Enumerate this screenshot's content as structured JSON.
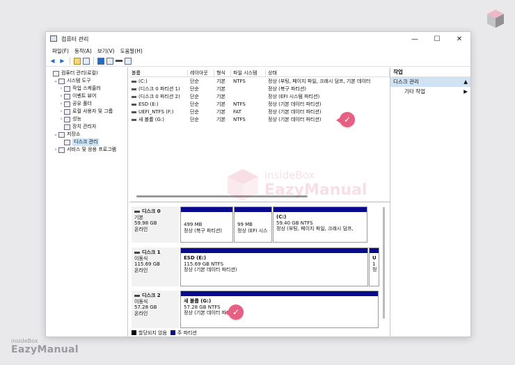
{
  "window": {
    "title": "컴퓨터 관리"
  },
  "branding": {
    "top": "insideBox",
    "bottom": "EazyManual"
  },
  "menu": [
    "파일(F)",
    "동작(A)",
    "보기(V)",
    "도움말(H)"
  ],
  "tree": [
    {
      "label": "컴퓨터 관리(로컬)",
      "indent": 0,
      "arrow": "",
      "selected": false
    },
    {
      "label": "시스템 도구",
      "indent": 1,
      "arrow": "⌄",
      "selected": false
    },
    {
      "label": "작업 스케줄러",
      "indent": 2,
      "arrow": "›",
      "selected": false
    },
    {
      "label": "이벤트 뷰어",
      "indent": 2,
      "arrow": "›",
      "selected": false
    },
    {
      "label": "공유 폴더",
      "indent": 2,
      "arrow": "›",
      "selected": false
    },
    {
      "label": "로컬 사용자 및 그룹",
      "indent": 2,
      "arrow": "›",
      "selected": false
    },
    {
      "label": "성능",
      "indent": 2,
      "arrow": "›",
      "selected": false
    },
    {
      "label": "장치 관리자",
      "indent": 2,
      "arrow": "",
      "selected": false
    },
    {
      "label": "저장소",
      "indent": 1,
      "arrow": "⌄",
      "selected": false
    },
    {
      "label": "디스크 관리",
      "indent": 2,
      "arrow": "",
      "selected": true
    },
    {
      "label": "서비스 및 응용 프로그램",
      "indent": 1,
      "arrow": "›",
      "selected": false
    }
  ],
  "volume_table": {
    "headers": [
      "볼륨",
      "레이아웃",
      "형식",
      "파일 시스템",
      "상태"
    ],
    "rows": [
      [
        "(C:)",
        "단순",
        "기본",
        "NTFS",
        "정상 (부팅, 페이지 파일, 크래시 덤프, 기본 데이터"
      ],
      [
        "(디스크 0 파티션 1)",
        "단순",
        "기본",
        "",
        "정상 (복구 파티션)"
      ],
      [
        "(디스크 0 파티션 2)",
        "단순",
        "기본",
        "",
        "정상 (EFI 시스템 파티션)"
      ],
      [
        "ESD (E:)",
        "단순",
        "기본",
        "NTFS",
        "정상 (기본 데이터 파티션)"
      ],
      [
        "UEFI_NTFS (F:)",
        "단순",
        "기본",
        "FAT",
        "정상 (기본 데이터 파티션)"
      ],
      [
        "새 볼륨 (G:)",
        "단순",
        "기본",
        "NTFS",
        "정상 (기본 데이터 파티션)"
      ]
    ]
  },
  "disks": [
    {
      "name": "디스크 0",
      "kind": "기본",
      "size": "59.98 GB",
      "status": "온라인",
      "partitions": [
        {
          "name": "",
          "size": "499 MB",
          "status": "정상 (복구 파티션)"
        },
        {
          "name": "",
          "size": "99 MB",
          "status": "정상 (EFI 시스"
        },
        {
          "name": "(C:)",
          "size": "59.40 GB NTFS",
          "status": "정상 (부팅, 페이지 파일, 크래시 덤프,"
        }
      ]
    },
    {
      "name": "디스크 1",
      "kind": "이동식",
      "size": "115.69 GB",
      "status": "온라인",
      "partitions": [
        {
          "name": "ESD (E:)",
          "size": "115.69 GB NTFS",
          "status": "정상 (기본 데이터 파티션)"
        },
        {
          "name": "U",
          "size": "1",
          "status": "정"
        }
      ]
    },
    {
      "name": "디스크 2",
      "kind": "이동식",
      "size": "57.28 GB",
      "status": "온라인",
      "partitions": [
        {
          "name": "새 볼륨 (G:)",
          "size": "57.28 GB NTFS",
          "status": "정상 (기본 데이터 파티션)"
        }
      ]
    }
  ],
  "legend": {
    "unallocated": "할당되지 않음",
    "primary": "주 파티션"
  },
  "actions": {
    "header": "작업",
    "group": "디스크 관리",
    "item": "기타 작업"
  },
  "watermark": {
    "line1": "insideBox",
    "line2": "EazyManual"
  },
  "colors": {
    "partition_bar": "#0a0a8f",
    "selection": "#cce4f7",
    "marker": "#e85f84"
  },
  "icons": {
    "check_marker": "check-icon",
    "minimize": "minimize-icon",
    "maximize": "maximize-icon",
    "close": "close-icon"
  }
}
